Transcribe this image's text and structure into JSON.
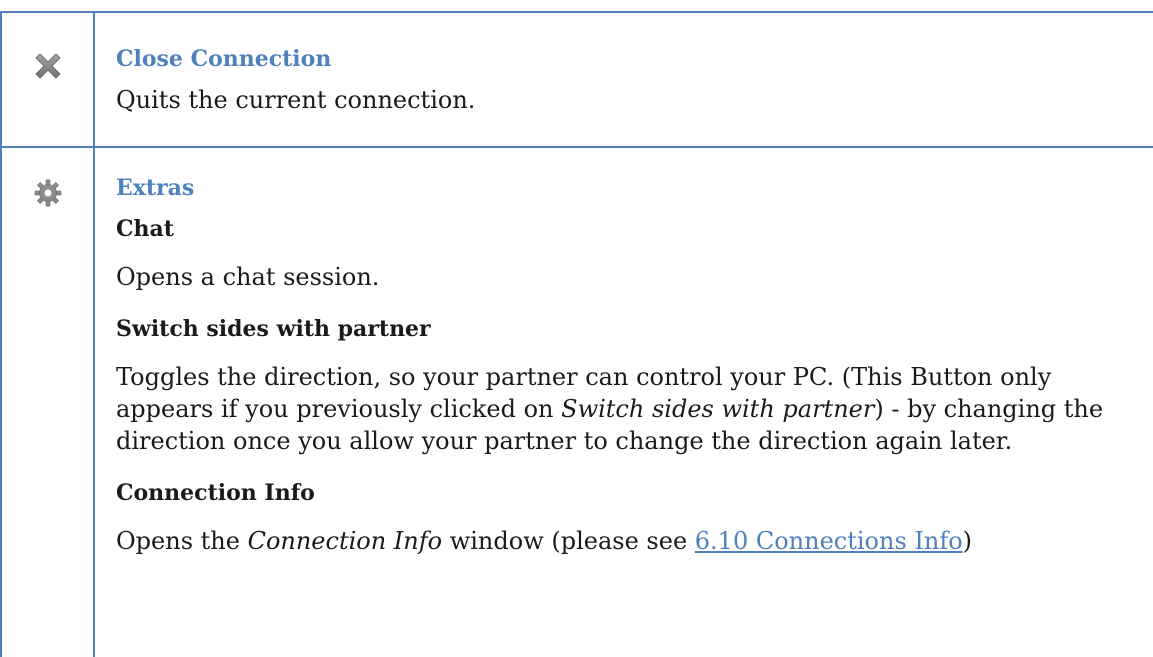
{
  "rows": {
    "close": {
      "icon": "close-x-icon",
      "title": "Close Connection",
      "description": "Quits the current connection."
    },
    "extras": {
      "icon": "gear-icon",
      "title": "Extras",
      "chat": {
        "title": "Chat",
        "description": "Opens a chat session."
      },
      "switch_sides": {
        "title": "Switch sides with partner",
        "desc_part1": "Toggles the direction, so your partner can control your PC. (This Button only appears if you previously clicked on ",
        "desc_italic": "Switch sides with partner",
        "desc_part2": ") - by changing the direction once you allow your partner to change the direction again later."
      },
      "connection_info": {
        "title": "Connection Info",
        "desc_prefix": "Opens the ",
        "desc_italic": "Connection Info",
        "desc_middle": " window (please see ",
        "link_text": "6.10 Connections Info",
        "desc_suffix": ")"
      }
    }
  },
  "colors": {
    "border": "#4f81bd",
    "heading": "#4f81bd",
    "link": "#4f81bd",
    "icon_gray": "#8c8c8c"
  }
}
